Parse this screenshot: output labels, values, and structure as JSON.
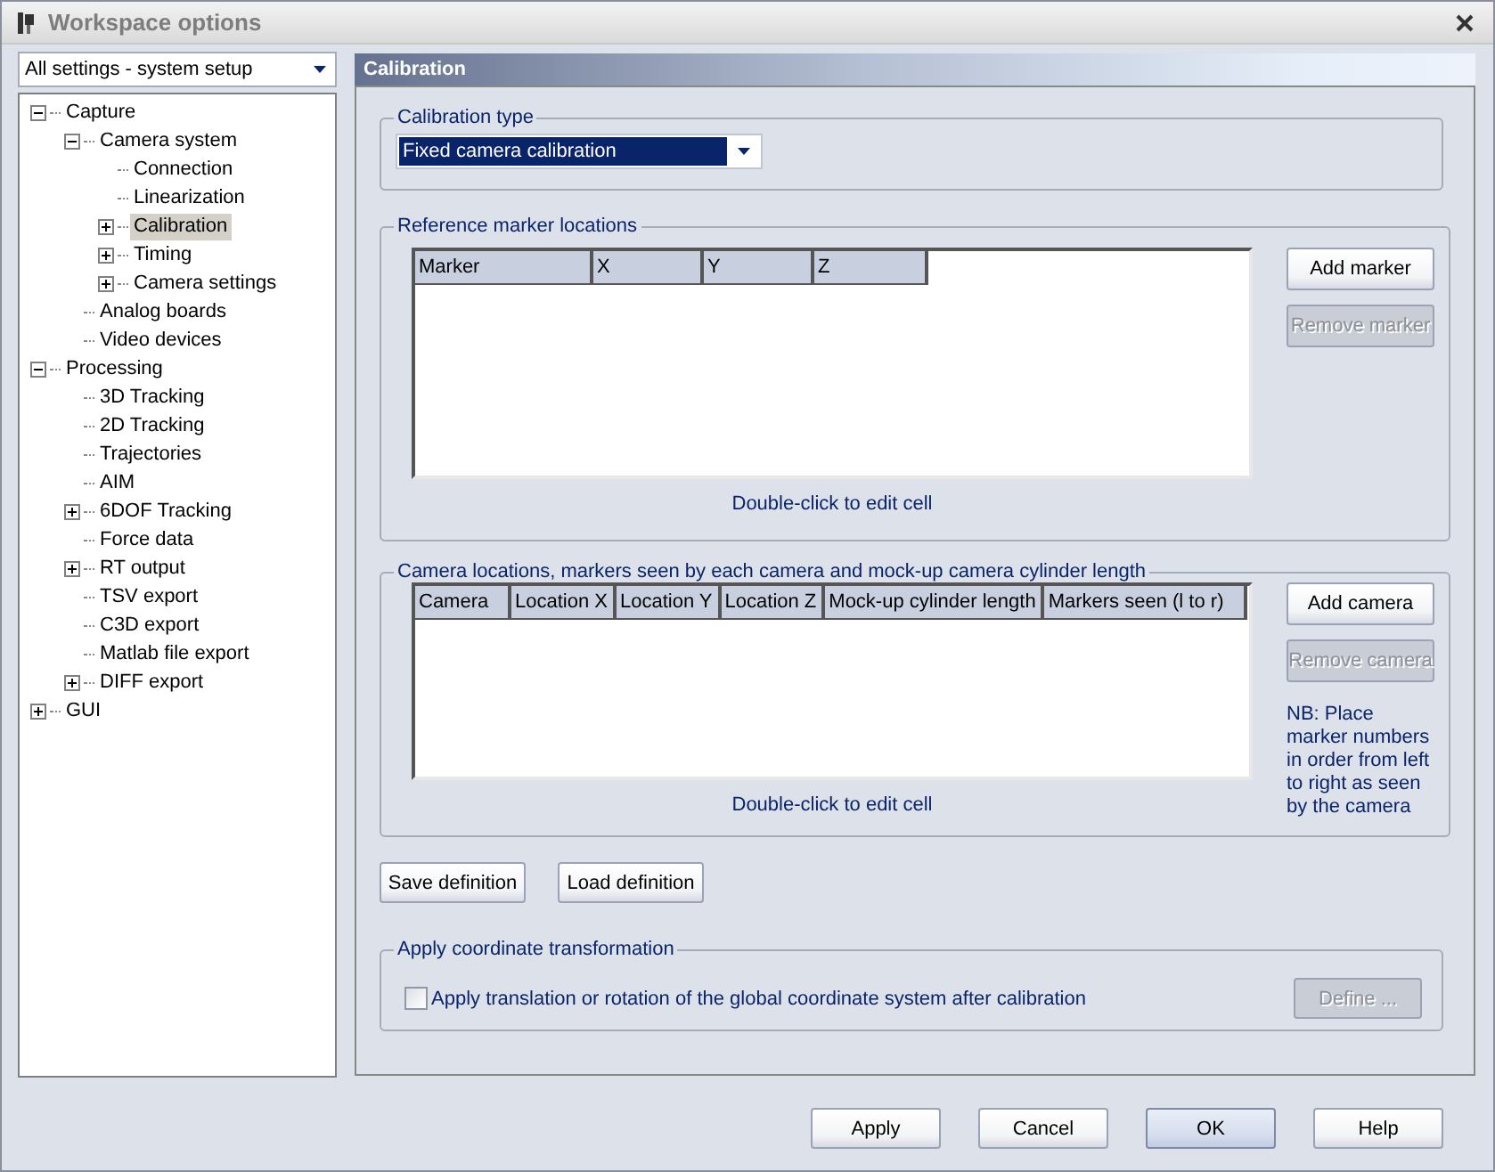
{
  "window": {
    "title": "Workspace options"
  },
  "settings_filter": {
    "value": "All settings - system setup"
  },
  "tree": [
    {
      "label": "Capture",
      "expanded": true,
      "selected": false,
      "children": [
        {
          "label": "Camera system",
          "expanded": true,
          "selected": false,
          "children": [
            {
              "label": "Connection",
              "selected": false
            },
            {
              "label": "Linearization",
              "selected": false
            },
            {
              "label": "Calibration",
              "expanded": false,
              "selected": true
            },
            {
              "label": "Timing",
              "expanded": false,
              "selected": false
            },
            {
              "label": "Camera settings",
              "expanded": false,
              "selected": false
            }
          ]
        },
        {
          "label": "Analog boards",
          "selected": false
        },
        {
          "label": "Video devices",
          "selected": false
        }
      ]
    },
    {
      "label": "Processing",
      "expanded": true,
      "selected": false,
      "children": [
        {
          "label": "3D Tracking",
          "selected": false
        },
        {
          "label": "2D Tracking",
          "selected": false
        },
        {
          "label": "Trajectories",
          "selected": false
        },
        {
          "label": "AIM",
          "selected": false
        },
        {
          "label": "6DOF Tracking",
          "expanded": false,
          "selected": false
        },
        {
          "label": "Force data",
          "selected": false
        },
        {
          "label": "RT output",
          "expanded": false,
          "selected": false
        },
        {
          "label": "TSV export",
          "selected": false
        },
        {
          "label": "C3D export",
          "selected": false
        },
        {
          "label": "Matlab file export",
          "selected": false
        },
        {
          "label": "DIFF export",
          "expanded": false,
          "selected": false
        }
      ]
    },
    {
      "label": "GUI",
      "expanded": false,
      "selected": false
    }
  ],
  "panel": {
    "title": "Calibration"
  },
  "calibration_type": {
    "label": "Calibration type",
    "value": "Fixed camera calibration"
  },
  "reference_markers": {
    "label": "Reference marker locations",
    "columns": [
      "Marker",
      "X",
      "Y",
      "Z"
    ],
    "hint": "Double-click to edit cell",
    "buttons": [
      {
        "label": "Add marker",
        "disabled": false
      },
      {
        "label": "Remove marker",
        "disabled": true
      }
    ]
  },
  "camera_locations": {
    "label": "Camera locations, markers seen by each camera and mock-up camera cylinder length",
    "columns": [
      "Camera",
      "Location X",
      "Location Y",
      "Location Z",
      "Mock-up cylinder length",
      "Markers seen (l to r)"
    ],
    "hint": "Double-click to edit cell",
    "buttons": [
      {
        "label": "Add camera",
        "disabled": false
      },
      {
        "label": "Remove camera",
        "disabled": true
      }
    ],
    "note": "NB: Place marker numbers in order from left to right as seen by the camera"
  },
  "definition_buttons": [
    {
      "label": "Save definition"
    },
    {
      "label": "Load definition"
    }
  ],
  "coordinate_transformation": {
    "label": "Apply coordinate transformation",
    "checkbox": {
      "label": "Apply translation or rotation of the global coordinate system after calibration",
      "checked": false
    },
    "button": {
      "label": "Define ...",
      "disabled": true
    }
  },
  "dialog_buttons": [
    {
      "label": "Apply",
      "default": false
    },
    {
      "label": "Cancel",
      "default": false
    },
    {
      "label": "OK",
      "default": true
    },
    {
      "label": "Help",
      "default": false
    }
  ]
}
